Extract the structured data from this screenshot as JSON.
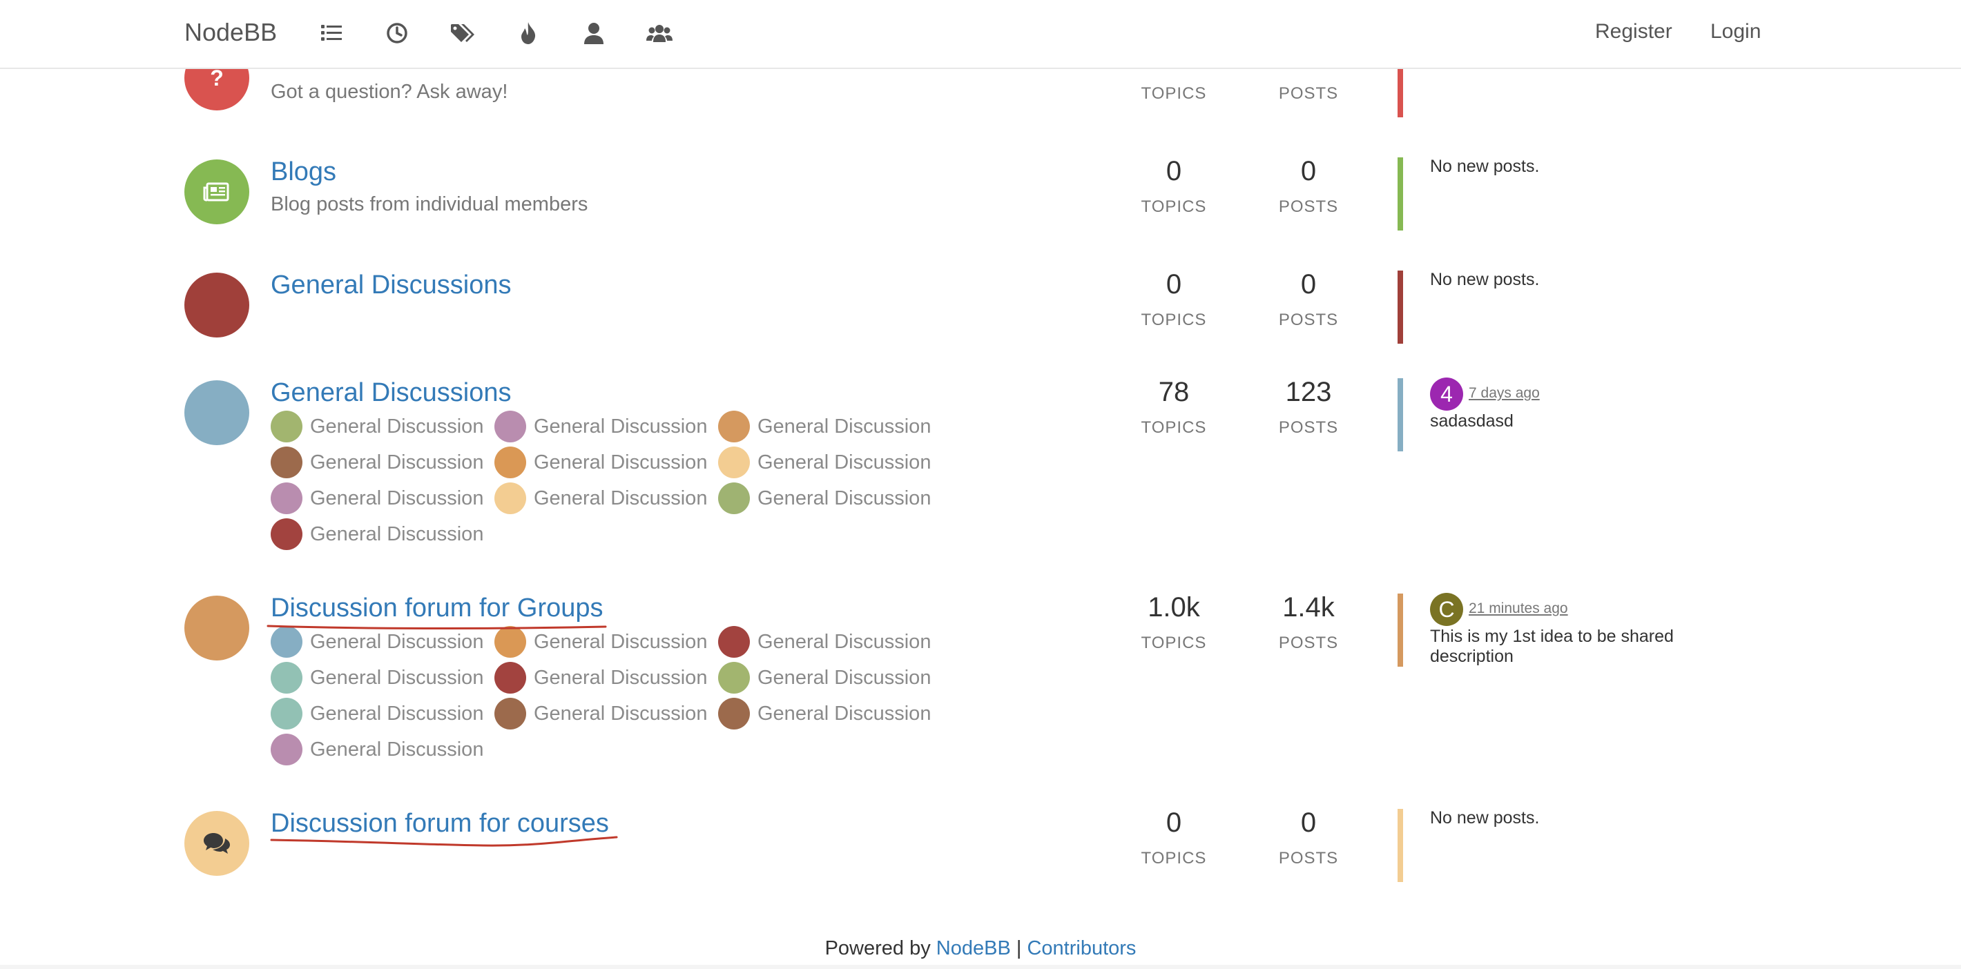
{
  "header": {
    "brand": "NodeBB",
    "icons": [
      "categories-icon",
      "recent-icon",
      "tags-icon",
      "popular-icon",
      "users-icon",
      "groups-icon"
    ],
    "register": "Register",
    "login": "Login"
  },
  "categories": [
    {
      "title": "",
      "description": "Got a question? Ask away!",
      "topics": "",
      "posts": "",
      "topics_label": "TOPICS",
      "posts_label": "POSTS",
      "color": "#d9534f",
      "icon": "question-icon",
      "teaser": ""
    },
    {
      "title": "Blogs",
      "description": "Blog posts from individual members",
      "topics": "0",
      "posts": "0",
      "topics_label": "TOPICS",
      "posts_label": "POSTS",
      "color": "#86b953",
      "icon": "newspaper-icon",
      "teaser": "No new posts."
    },
    {
      "title": "General Discussions",
      "description": "",
      "topics": "0",
      "posts": "0",
      "topics_label": "TOPICS",
      "posts_label": "POSTS",
      "color": "#a0403a",
      "icon": "none",
      "teaser": "No new posts."
    },
    {
      "title": "General Discussions",
      "topics": "78",
      "posts": "123",
      "topics_label": "TOPICS",
      "posts_label": "POSTS",
      "color": "#86aec3",
      "icon": "none",
      "teaser_avatar": "4",
      "teaser_time": "7 days ago",
      "teaser": "sadasdasd",
      "subcategories": [
        {
          "label": "General Discussion",
          "color": "#a2b56f"
        },
        {
          "label": "General Discussion",
          "color": "#b98daf"
        },
        {
          "label": "General Discussion",
          "color": "#d5995f"
        },
        {
          "label": "General Discussion",
          "color": "#9c6a4c"
        },
        {
          "label": "General Discussion",
          "color": "#da9855"
        },
        {
          "label": "General Discussion",
          "color": "#f3cd92"
        },
        {
          "label": "General Discussion",
          "color": "#b98daf"
        },
        {
          "label": "General Discussion",
          "color": "#f3cd92"
        },
        {
          "label": "General Discussion",
          "color": "#9fb372"
        },
        {
          "label": "General Discussion",
          "color": "#a2433f"
        }
      ]
    },
    {
      "title": "Discussion forum for Groups",
      "topics": "1.0k",
      "posts": "1.4k",
      "topics_label": "TOPICS",
      "posts_label": "POSTS",
      "color": "#d5995f",
      "icon": "none",
      "teaser_avatar": "C",
      "teaser_time": "21 minutes ago",
      "teaser": "This is my 1st idea to be shared description",
      "subcategories": [
        {
          "label": "General Discussion",
          "color": "#86aec3"
        },
        {
          "label": "General Discussion",
          "color": "#da9855"
        },
        {
          "label": "General Discussion",
          "color": "#a2433f"
        },
        {
          "label": "General Discussion",
          "color": "#92c1b4"
        },
        {
          "label": "General Discussion",
          "color": "#a2433f"
        },
        {
          "label": "General Discussion",
          "color": "#a2b56f"
        },
        {
          "label": "General Discussion",
          "color": "#92c1b4"
        },
        {
          "label": "General Discussion",
          "color": "#9c6a4c"
        },
        {
          "label": "General Discussion",
          "color": "#9c6a4c"
        },
        {
          "label": "General Discussion",
          "color": "#b98daf"
        }
      ]
    },
    {
      "title": "Discussion forum for courses",
      "topics": "0",
      "posts": "0",
      "topics_label": "TOPICS",
      "posts_label": "POSTS",
      "color": "#f3cd92",
      "icon": "comments-icon",
      "teaser": "No new posts."
    }
  ],
  "footer": {
    "prefix": "Powered by",
    "nodebb_link": "NodeBB",
    "separator": "|",
    "contributors_link": "Contributors"
  },
  "colors": {
    "link": "#337ab7",
    "annotation": "#c0392b",
    "avatar_4": "#9c27b0",
    "avatar_c": "#7a7324"
  }
}
